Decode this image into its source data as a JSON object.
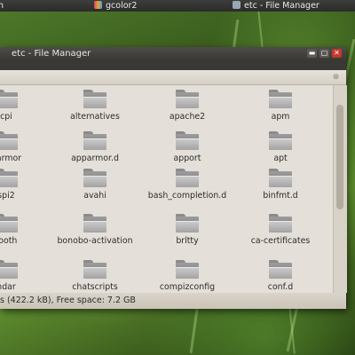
{
  "taskbar": {
    "items": [
      {
        "label": "n",
        "icon": "app-icon",
        "color": "#8a8a8a"
      },
      {
        "label": "gcolor2",
        "icon": "color-palette-icon",
        "color": "#d05a8a"
      },
      {
        "label": "etc - File Manager",
        "icon": "file-manager-icon",
        "color": "#9aa7b5"
      }
    ]
  },
  "window": {
    "title": "etc - File Manager",
    "controls": {
      "minimize": "▬",
      "maximize": "▢",
      "close": "✕"
    },
    "search_clear": "⊗",
    "status": "s (422.2 kB), Free space: 7.2 GB"
  },
  "files": [
    {
      "name": "cpi"
    },
    {
      "name": "alternatives"
    },
    {
      "name": "apache2"
    },
    {
      "name": "apm"
    },
    {
      "name": "parmor"
    },
    {
      "name": "apparmor.d"
    },
    {
      "name": "apport"
    },
    {
      "name": "apt"
    },
    {
      "name": "spi2"
    },
    {
      "name": "avahi"
    },
    {
      "name": "bash_completion.d"
    },
    {
      "name": "binfmt.d"
    },
    {
      "name": "tooth"
    },
    {
      "name": "bonobo-activation"
    },
    {
      "name": "brltty"
    },
    {
      "name": "ca-certificates"
    },
    {
      "name": "ndar"
    },
    {
      "name": "chatscripts"
    },
    {
      "name": "compizconfig"
    },
    {
      "name": "conf.d"
    }
  ]
}
